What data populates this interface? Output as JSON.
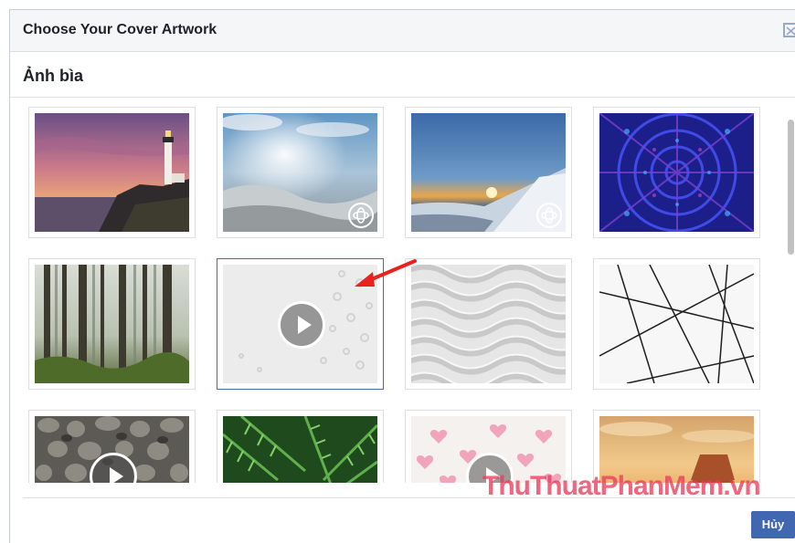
{
  "dialog": {
    "title": "Choose Your Cover Artwork",
    "section_title": "Ảnh bìa",
    "cancel_label": "Hủy"
  },
  "icons": {
    "close": "close-icon",
    "badge_360": "panorama-360-icon",
    "play": "play-icon"
  },
  "thumbnails": [
    {
      "row": 1,
      "col": 1,
      "subject": "lighthouse",
      "badge": "none"
    },
    {
      "row": 1,
      "col": 2,
      "subject": "clouds",
      "badge": "360"
    },
    {
      "row": 1,
      "col": 3,
      "subject": "mountain-sunrise",
      "badge": "360"
    },
    {
      "row": 1,
      "col": 4,
      "subject": "kaleidoscope",
      "badge": "none"
    },
    {
      "row": 2,
      "col": 1,
      "subject": "forest",
      "badge": "none"
    },
    {
      "row": 2,
      "col": 2,
      "subject": "embossed-white",
      "badge": "video",
      "selected": true
    },
    {
      "row": 2,
      "col": 3,
      "subject": "wavy-pattern",
      "badge": "none"
    },
    {
      "row": 2,
      "col": 4,
      "subject": "line-art",
      "badge": "none"
    },
    {
      "row": 3,
      "col": 1,
      "subject": "rocks",
      "badge": "video"
    },
    {
      "row": 3,
      "col": 2,
      "subject": "fern",
      "badge": "none"
    },
    {
      "row": 3,
      "col": 3,
      "subject": "hearts",
      "badge": "video"
    },
    {
      "row": 3,
      "col": 4,
      "subject": "desert-sunset",
      "badge": "none"
    }
  ],
  "watermark": "ThuThuatPhanMem.vn",
  "colors": {
    "primary_button": "#4267b2",
    "selection_border": "#4b6aa5",
    "annotation_arrow": "#e8231f",
    "watermark": "#eb3c5a"
  }
}
